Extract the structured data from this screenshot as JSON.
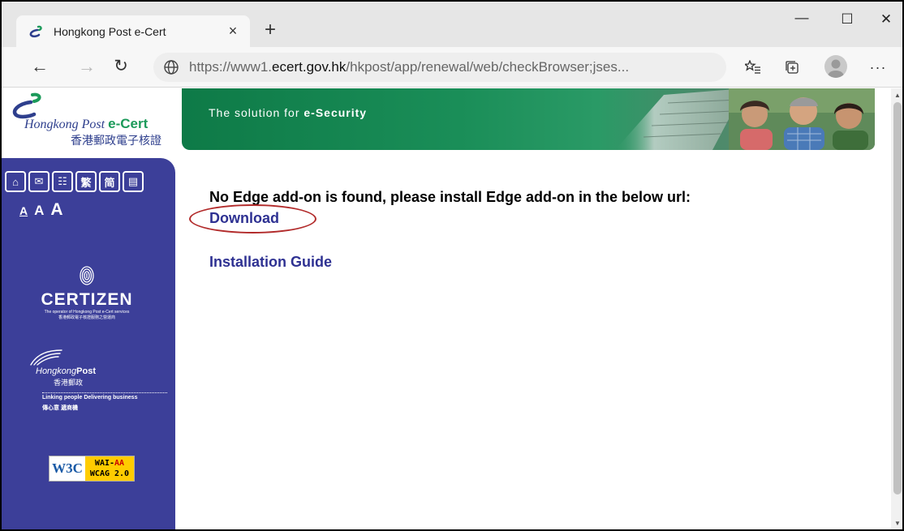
{
  "browser": {
    "tab_title": "Hongkong Post e-Cert",
    "tab_close": "×",
    "new_tab": "+",
    "window_controls": {
      "minimize": "—",
      "maximize": "☐",
      "close": "✕"
    },
    "url_domain_prefix": "https://www1.",
    "url_domain": "ecert.gov.hk",
    "url_path": "/hkpost/app/renewal/web/checkBrowser;jses...",
    "nav": {
      "back": "←",
      "forward": "→",
      "refresh": "↻"
    },
    "more": "···",
    "icons": [
      "favicon-icon",
      "globe-icon",
      "favorites-icon",
      "collections-icon",
      "profile-icon"
    ]
  },
  "header": {
    "logo_en_prefix": "Hongkong Post",
    "logo_en_brand": "e-Cert",
    "logo_zh": "香港郵政電子核證",
    "banner_text_prefix": "The solution for ",
    "banner_text_bold": "e-Security"
  },
  "sidebar": {
    "util_buttons": [
      {
        "name": "home-icon",
        "glyph": "⌂"
      },
      {
        "name": "mail-icon",
        "glyph": "✉"
      },
      {
        "name": "sitemap-icon",
        "glyph": "☷"
      },
      {
        "name": "traditional-chinese-button",
        "glyph": "繁"
      },
      {
        "name": "simplified-chinese-button",
        "glyph": "简"
      },
      {
        "name": "text-only-icon",
        "glyph": "▤"
      }
    ],
    "font_small": "A",
    "font_medium": "A",
    "font_large": "A",
    "certizen_word": "CERTIZEN",
    "certizen_sub_en": "The operator of Hongkong Post e-Cert services",
    "certizen_sub_zh": "香港郵政電子核證服務之營運商",
    "hkpost_name": "Hongkong",
    "hkpost_name_bold": "Post",
    "hkpost_zh": "香港郵政",
    "hkpost_tagline": "Linking people Delivering business",
    "hkpost_tagline_zh": "傳心意 遞商機",
    "w3c_logo": "W3C",
    "w3c_wai": "WAI-",
    "w3c_aa": "AA",
    "w3c_wcag": "WCAG 2.0"
  },
  "main": {
    "message": "No Edge add-on is found, please install Edge add-on in the below url:",
    "download_link": "Download",
    "guide_link": "Installation Guide"
  },
  "colors": {
    "sidebar_bg": "#3c3f99",
    "banner_green": "#1a8e58",
    "link": "#2e3192",
    "annotation": "#b22b2b"
  }
}
